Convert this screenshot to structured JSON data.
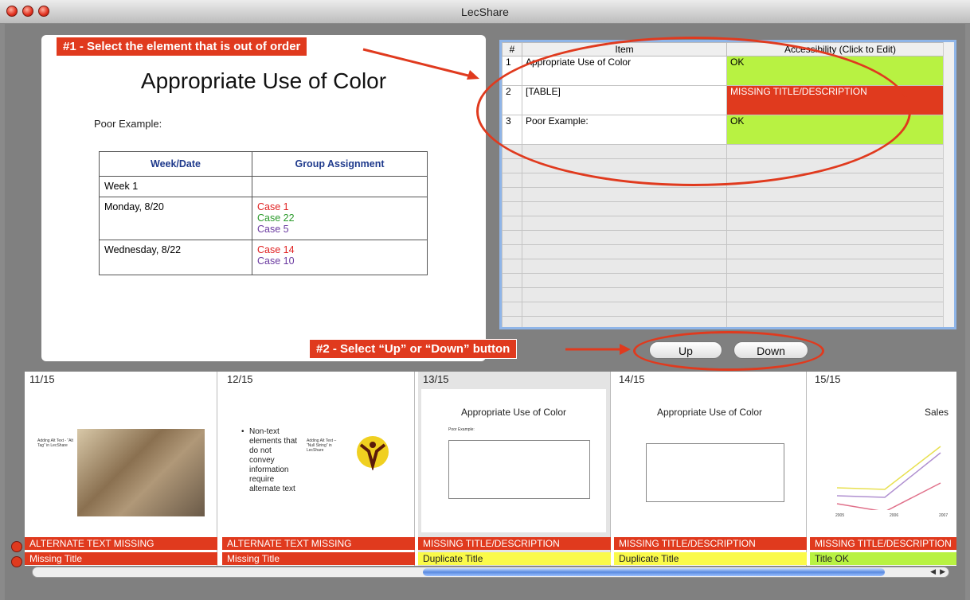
{
  "window": {
    "title": "LecShare"
  },
  "slide": {
    "title": "Appropriate Use of Color",
    "subtitle": "Poor Example:",
    "table": {
      "headers": [
        "Week/Date",
        "Group Assignment"
      ],
      "rows": [
        {
          "date": "Week 1",
          "cases": []
        },
        {
          "date": "Monday, 8/20",
          "cases": [
            {
              "text": "Case 1",
              "color": "red"
            },
            {
              "text": "Case 22",
              "color": "green"
            },
            {
              "text": "Case 5",
              "color": "purple"
            }
          ]
        },
        {
          "date": "Wednesday, 8/22",
          "cases": [
            {
              "text": "Case 14",
              "color": "red"
            },
            {
              "text": "Case 10",
              "color": "purple"
            }
          ]
        }
      ]
    }
  },
  "callouts": {
    "step1": "#1 - Select the element that is out of order",
    "step2": "#2 - Select “Up” or “Down” button"
  },
  "grid": {
    "headers": [
      "#",
      "Item",
      "Accessibility (Click to Edit)"
    ],
    "rows": [
      {
        "num": "1",
        "item": "Appropriate Use of Color",
        "status": "OK",
        "state": "ok"
      },
      {
        "num": "2",
        "item": "[TABLE]",
        "status": "MISSING TITLE/DESCRIPTION",
        "state": "bad"
      },
      {
        "num": "3",
        "item": "Poor Example:",
        "status": "OK",
        "state": "ok"
      }
    ]
  },
  "buttons": {
    "up": "Up",
    "down": "Down"
  },
  "thumbnails": [
    {
      "num": "11/15",
      "status1": "ALTERNATE TEXT MISSING",
      "status2": "Missing Title",
      "s1": "red",
      "s2": "red",
      "alt_caption": "Adding Alt Text - “Alt Tag” in LecShare"
    },
    {
      "num": "12/15",
      "status1": "ALTERNATE TEXT MISSING",
      "status2": "Missing Title",
      "s1": "red",
      "s2": "red",
      "bullet": "Non-text elements that do not convey information require alternate text",
      "alt_caption": "Adding Alt Text – “Null String” in LecShare"
    },
    {
      "num": "13/15",
      "status1": "MISSING TITLE/DESCRIPTION",
      "status2": "Duplicate Title",
      "s1": "red",
      "s2": "yellow",
      "title": "Appropriate Use of Color",
      "sub": "Poor Example:"
    },
    {
      "num": "14/15",
      "status1": "MISSING TITLE/DESCRIPTION",
      "status2": "Duplicate Title",
      "s1": "red",
      "s2": "yellow",
      "title": "Appropriate Use of Color"
    },
    {
      "num": "15/15",
      "status1": "MISSING TITLE/DESCRIPTION",
      "status2": "Title OK",
      "s1": "red",
      "s2": "green",
      "title": "Sales",
      "years": [
        "2005",
        "2006",
        "2007"
      ]
    }
  ],
  "colors": {
    "error": "#e03a1e",
    "ok": "#b8f242",
    "warn": "#fafa4a",
    "header_blue": "#1f3a8c"
  },
  "icons": [
    "window-close-icon",
    "window-minimize-icon",
    "window-zoom-icon",
    "scroll-left-icon",
    "scroll-right-icon"
  ]
}
